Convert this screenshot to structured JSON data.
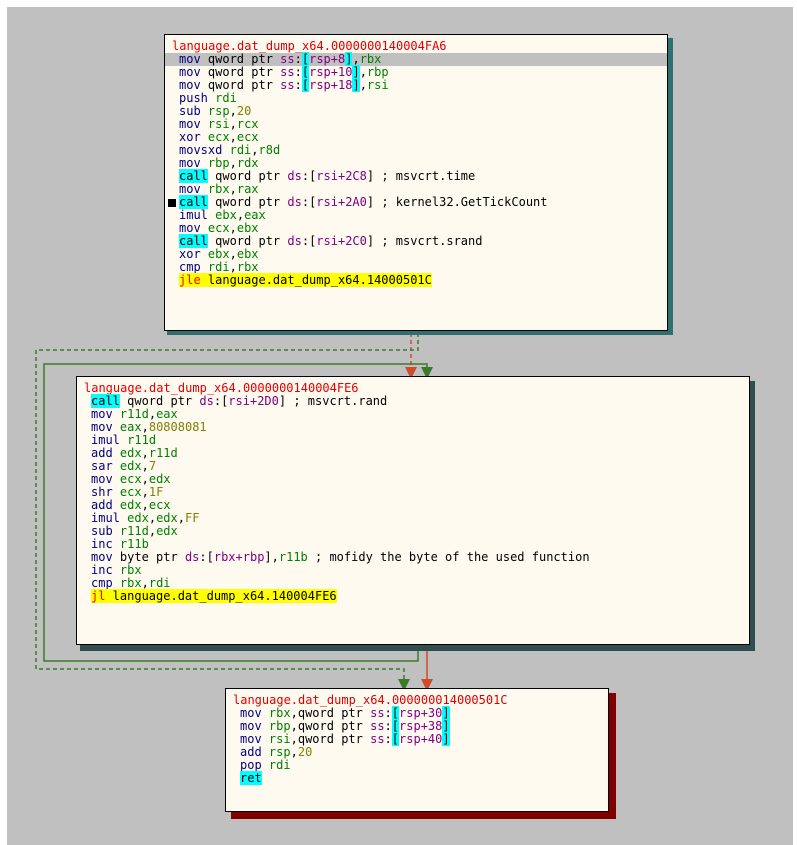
{
  "blocks": [
    {
      "title": "language.dat_dump_x64.0000000140004FA6",
      "lines": [
        [
          [
            "mov",
            "mn"
          ],
          [
            " qword ptr ",
            "txt"
          ],
          [
            "ss",
            "seg"
          ],
          [
            ":",
            "txt"
          ],
          [
            "[",
            "bra"
          ],
          [
            "rsp+8",
            "bra-in"
          ],
          [
            "]",
            "bra"
          ],
          [
            ",",
            "txt"
          ],
          [
            "rbx",
            "reg"
          ]
        ],
        [
          [
            "mov",
            "mn"
          ],
          [
            " qword ptr ",
            "txt"
          ],
          [
            "ss",
            "seg"
          ],
          [
            ":",
            "txt"
          ],
          [
            "[",
            "bra"
          ],
          [
            "rsp+10",
            "bra-in"
          ],
          [
            "]",
            "bra"
          ],
          [
            ",",
            "txt"
          ],
          [
            "rbp",
            "reg"
          ]
        ],
        [
          [
            "mov",
            "mn"
          ],
          [
            " qword ptr ",
            "txt"
          ],
          [
            "ss",
            "seg"
          ],
          [
            ":",
            "txt"
          ],
          [
            "[",
            "bra"
          ],
          [
            "rsp+18",
            "bra-in"
          ],
          [
            "]",
            "bra"
          ],
          [
            ",",
            "txt"
          ],
          [
            "rsi",
            "reg"
          ]
        ],
        [
          [
            "push",
            "mn"
          ],
          [
            " ",
            "txt"
          ],
          [
            "rdi",
            "reg"
          ]
        ],
        [
          [
            "sub",
            "mn"
          ],
          [
            " ",
            "txt"
          ],
          [
            "rsp",
            "reg"
          ],
          [
            ",",
            "txt"
          ],
          [
            "20",
            "num"
          ]
        ],
        [
          [
            "mov",
            "mn"
          ],
          [
            " ",
            "txt"
          ],
          [
            "rsi",
            "reg"
          ],
          [
            ",",
            "txt"
          ],
          [
            "rcx",
            "reg"
          ]
        ],
        [
          [
            "xor",
            "mn"
          ],
          [
            " ",
            "txt"
          ],
          [
            "ecx",
            "reg"
          ],
          [
            ",",
            "txt"
          ],
          [
            "ecx",
            "reg"
          ]
        ],
        [
          [
            "movsxd",
            "mn"
          ],
          [
            " ",
            "txt"
          ],
          [
            "rdi",
            "reg"
          ],
          [
            ",",
            "txt"
          ],
          [
            "r8d",
            "reg"
          ]
        ],
        [
          [
            "mov",
            "mn"
          ],
          [
            " ",
            "txt"
          ],
          [
            "rbp",
            "reg"
          ],
          [
            ",",
            "txt"
          ],
          [
            "rdx",
            "reg"
          ]
        ],
        [
          [
            "call",
            "mn-call"
          ],
          [
            " qword ptr ",
            "txt"
          ],
          [
            "ds",
            "seg"
          ],
          [
            ":[",
            "txt"
          ],
          [
            "rsi+2C8",
            "seg"
          ],
          [
            "] ; msvcrt.time",
            "cmt"
          ]
        ],
        [
          [
            "mov",
            "mn"
          ],
          [
            " ",
            "txt"
          ],
          [
            "rbx",
            "reg"
          ],
          [
            ",",
            "txt"
          ],
          [
            "rax",
            "reg"
          ]
        ],
        [
          [
            "call",
            "mn-call"
          ],
          [
            " qword ptr ",
            "txt"
          ],
          [
            "ds",
            "seg"
          ],
          [
            ":[",
            "txt"
          ],
          [
            "rsi+2A0",
            "seg"
          ],
          [
            "] ; kernel32.GetTickCount",
            "cmt"
          ]
        ],
        [
          [
            "imul",
            "mn"
          ],
          [
            " ",
            "txt"
          ],
          [
            "ebx",
            "reg"
          ],
          [
            ",",
            "txt"
          ],
          [
            "eax",
            "reg"
          ]
        ],
        [
          [
            "mov",
            "mn"
          ],
          [
            " ",
            "txt"
          ],
          [
            "ecx",
            "reg"
          ],
          [
            ",",
            "txt"
          ],
          [
            "ebx",
            "reg"
          ]
        ],
        [
          [
            "call",
            "mn-call"
          ],
          [
            " qword ptr ",
            "txt"
          ],
          [
            "ds",
            "seg"
          ],
          [
            ":[",
            "txt"
          ],
          [
            "rsi+2C0",
            "seg"
          ],
          [
            "] ; msvcrt.srand",
            "cmt"
          ]
        ],
        [
          [
            "xor",
            "mn"
          ],
          [
            " ",
            "txt"
          ],
          [
            "ebx",
            "reg"
          ],
          [
            ",",
            "txt"
          ],
          [
            "ebx",
            "reg"
          ]
        ],
        [
          [
            "cmp",
            "mn"
          ],
          [
            " ",
            "txt"
          ],
          [
            "rdi",
            "reg"
          ],
          [
            ",",
            "txt"
          ],
          [
            "rbx",
            "reg"
          ]
        ],
        [
          [
            "jle",
            "mn-jmp"
          ],
          [
            " language.dat_dump_x64.14000501C",
            "tgt"
          ]
        ]
      ]
    },
    {
      "title": "language.dat_dump_x64.0000000140004FE6",
      "lines": [
        [
          [
            "call",
            "mn-call"
          ],
          [
            " qword ptr ",
            "txt"
          ],
          [
            "ds",
            "seg"
          ],
          [
            ":[",
            "txt"
          ],
          [
            "rsi+2D0",
            "seg"
          ],
          [
            "] ; msvcrt.rand",
            "cmt"
          ]
        ],
        [
          [
            "mov",
            "mn"
          ],
          [
            " ",
            "txt"
          ],
          [
            "r11d",
            "reg"
          ],
          [
            ",",
            "txt"
          ],
          [
            "eax",
            "reg"
          ]
        ],
        [
          [
            "mov",
            "mn"
          ],
          [
            " ",
            "txt"
          ],
          [
            "eax",
            "reg"
          ],
          [
            ",",
            "txt"
          ],
          [
            "80808081",
            "num"
          ]
        ],
        [
          [
            "imul",
            "mn"
          ],
          [
            " ",
            "txt"
          ],
          [
            "r11d",
            "reg"
          ]
        ],
        [
          [
            "add",
            "mn"
          ],
          [
            " ",
            "txt"
          ],
          [
            "edx",
            "reg"
          ],
          [
            ",",
            "txt"
          ],
          [
            "r11d",
            "reg"
          ]
        ],
        [
          [
            "sar",
            "mn"
          ],
          [
            " ",
            "txt"
          ],
          [
            "edx",
            "reg"
          ],
          [
            ",",
            "txt"
          ],
          [
            "7",
            "num"
          ]
        ],
        [
          [
            "mov",
            "mn"
          ],
          [
            " ",
            "txt"
          ],
          [
            "ecx",
            "reg"
          ],
          [
            ",",
            "txt"
          ],
          [
            "edx",
            "reg"
          ]
        ],
        [
          [
            "shr",
            "mn"
          ],
          [
            " ",
            "txt"
          ],
          [
            "ecx",
            "reg"
          ],
          [
            ",",
            "txt"
          ],
          [
            "1F",
            "num"
          ]
        ],
        [
          [
            "add",
            "mn"
          ],
          [
            " ",
            "txt"
          ],
          [
            "edx",
            "reg"
          ],
          [
            ",",
            "txt"
          ],
          [
            "ecx",
            "reg"
          ]
        ],
        [
          [
            "imul",
            "mn"
          ],
          [
            " ",
            "txt"
          ],
          [
            "edx",
            "reg"
          ],
          [
            ",",
            "txt"
          ],
          [
            "edx",
            "reg"
          ],
          [
            ",",
            "txt"
          ],
          [
            "FF",
            "num"
          ]
        ],
        [
          [
            "sub",
            "mn"
          ],
          [
            " ",
            "txt"
          ],
          [
            "r11d",
            "reg"
          ],
          [
            ",",
            "txt"
          ],
          [
            "edx",
            "reg"
          ]
        ],
        [
          [
            "inc",
            "mn"
          ],
          [
            " ",
            "txt"
          ],
          [
            "r11b",
            "reg"
          ]
        ],
        [
          [
            "mov",
            "mn"
          ],
          [
            " byte ptr ",
            "txt"
          ],
          [
            "ds",
            "seg"
          ],
          [
            ":[",
            "txt"
          ],
          [
            "rbx+rbp",
            "seg"
          ],
          [
            "],",
            "txt"
          ],
          [
            "r11b",
            "reg"
          ],
          [
            " ; mofidy the byte of the used function",
            "cmt"
          ]
        ],
        [
          [
            "inc",
            "mn"
          ],
          [
            " ",
            "txt"
          ],
          [
            "rbx",
            "reg"
          ]
        ],
        [
          [
            "cmp",
            "mn"
          ],
          [
            " ",
            "txt"
          ],
          [
            "rbx",
            "reg"
          ],
          [
            ",",
            "txt"
          ],
          [
            "rdi",
            "reg"
          ]
        ],
        [
          [
            "jl",
            "mn-jmp"
          ],
          [
            " language.dat_dump_x64.140004FE6",
            "tgt"
          ]
        ]
      ]
    },
    {
      "title": "language.dat_dump_x64.000000014000501C",
      "lines": [
        [
          [
            "mov",
            "mn"
          ],
          [
            " ",
            "txt"
          ],
          [
            "rbx",
            "reg"
          ],
          [
            ",",
            "txt"
          ],
          [
            "qword ptr ",
            "txt"
          ],
          [
            "ss",
            "seg"
          ],
          [
            ":",
            "txt"
          ],
          [
            "[",
            "bra"
          ],
          [
            "rsp+30",
            "bra-in"
          ],
          [
            "]",
            "bra"
          ]
        ],
        [
          [
            "mov",
            "mn"
          ],
          [
            " ",
            "txt"
          ],
          [
            "rbp",
            "reg"
          ],
          [
            ",",
            "txt"
          ],
          [
            "qword ptr ",
            "txt"
          ],
          [
            "ss",
            "seg"
          ],
          [
            ":",
            "txt"
          ],
          [
            "[",
            "bra"
          ],
          [
            "rsp+38",
            "bra-in"
          ],
          [
            "]",
            "bra"
          ]
        ],
        [
          [
            "mov",
            "mn"
          ],
          [
            " ",
            "txt"
          ],
          [
            "rsi",
            "reg"
          ],
          [
            ",",
            "txt"
          ],
          [
            "qword ptr ",
            "txt"
          ],
          [
            "ss",
            "seg"
          ],
          [
            ":",
            "txt"
          ],
          [
            "[",
            "bra"
          ],
          [
            "rsp+40",
            "bra-in"
          ],
          [
            "]",
            "bra"
          ]
        ],
        [
          [
            "add",
            "mn"
          ],
          [
            " ",
            "txt"
          ],
          [
            "rsp",
            "reg"
          ],
          [
            ",",
            "txt"
          ],
          [
            "20",
            "num"
          ]
        ],
        [
          [
            "pop",
            "mn"
          ],
          [
            " ",
            "txt"
          ],
          [
            "rdi",
            "reg"
          ]
        ],
        [
          [
            "ret",
            "mn-call"
          ]
        ]
      ]
    }
  ],
  "colors": {
    "canvas": "#c0c0c0",
    "block_bg": "#fffaf0",
    "shadow_block_1": "#2f6f6f",
    "shadow_block_2": "#2f4f4f",
    "shadow_block_3": "#800000",
    "edge_true": "#3a7a2a",
    "edge_false": "#d04a2a"
  }
}
